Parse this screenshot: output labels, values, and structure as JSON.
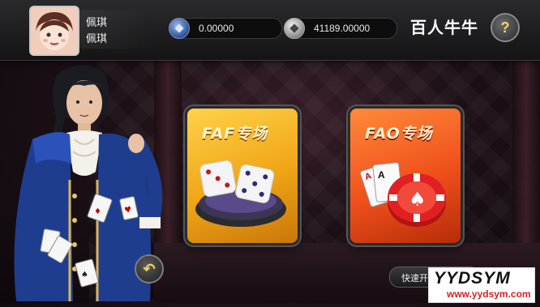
{
  "player": {
    "name_line1": "佩琪",
    "name_line2": "佩琪",
    "avatar_icon": "girl-avatar-icon"
  },
  "balances": {
    "primary": "0.00000",
    "primary_icon": "blue-diamond-coin-icon",
    "secondary": "41189.00000",
    "secondary_icon": "silver-diamond-coin-icon"
  },
  "header": {
    "game_title": "百人牛牛",
    "help_label": "?"
  },
  "rooms": [
    {
      "label": "FAF专场",
      "art_icon": "dice-icon",
      "color": "#f2a818"
    },
    {
      "label": "FAO专场",
      "art_icon": "poker-chip-cards-icon",
      "color": "#f0501b"
    }
  ],
  "controls": {
    "back_icon": "back-arrow-icon",
    "quick_start_label": "快速开始"
  },
  "watermark": {
    "big": "YYDSYM",
    "small": "www.yydsym.com"
  }
}
